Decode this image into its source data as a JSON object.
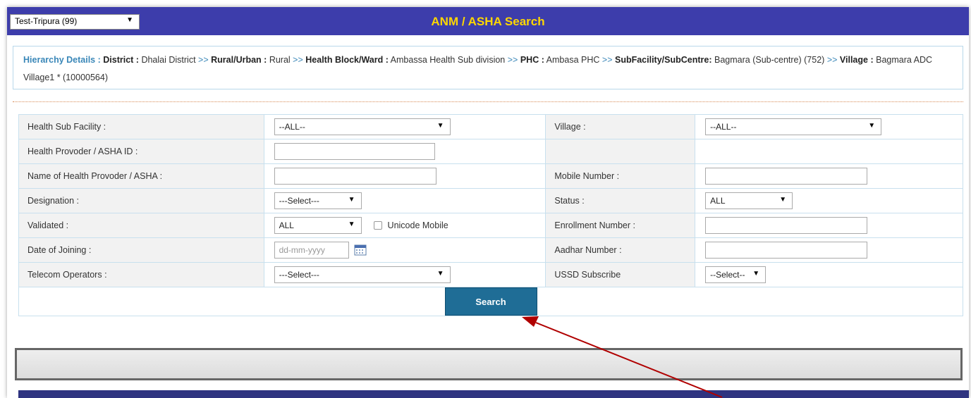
{
  "header": {
    "region_select": "Test-Tripura (99)",
    "title": "ANM / ASHA Search"
  },
  "hierarchy": {
    "lead": "Hierarchy Details :",
    "district_label": "District :",
    "district": "Dhalai District",
    "sep": ">>",
    "area_label": "Rural/Urban :",
    "area": "Rural",
    "block_label": "Health Block/Ward :",
    "block": "Ambassa Health Sub division",
    "phc_label": "PHC :",
    "phc": "Ambasa PHC",
    "subfac_label": "SubFacility/SubCentre:",
    "subfac": "Bagmara (Sub-centre) (752)",
    "village_label": "Village :",
    "village": "Bagmara ADC Village1 * (10000564)"
  },
  "form": {
    "health_sub_facility_label": "Health Sub Facility :",
    "health_sub_facility_value": "--ALL--",
    "village_label": "Village :",
    "village_value": "--ALL--",
    "provider_id_label": "Health Provoder / ASHA ID :",
    "provider_name_label": "Name of Health Provoder / ASHA :",
    "mobile_label": "Mobile Number :",
    "designation_label": "Designation :",
    "designation_value": "---Select---",
    "status_label": "Status :",
    "status_value": "ALL",
    "validated_label": "Validated :",
    "validated_value": "ALL",
    "unicode_mobile_label": "Unicode Mobile",
    "enrollment_label": "Enrollment Number :",
    "doj_label": "Date of Joining  :",
    "doj_placeholder": "dd-mm-yyyy",
    "aadhar_label": "Aadhar Number :",
    "telecom_label": "Telecom Operators :",
    "telecom_value": "---Select---",
    "ussd_label": "USSD Subscribe",
    "ussd_value": "--Select--",
    "search_button": "Search"
  },
  "colors": {
    "header_bg": "#3d3dab",
    "title": "#ffd700",
    "button": "#1f6d96",
    "annotation_arrow": "#b00000"
  }
}
